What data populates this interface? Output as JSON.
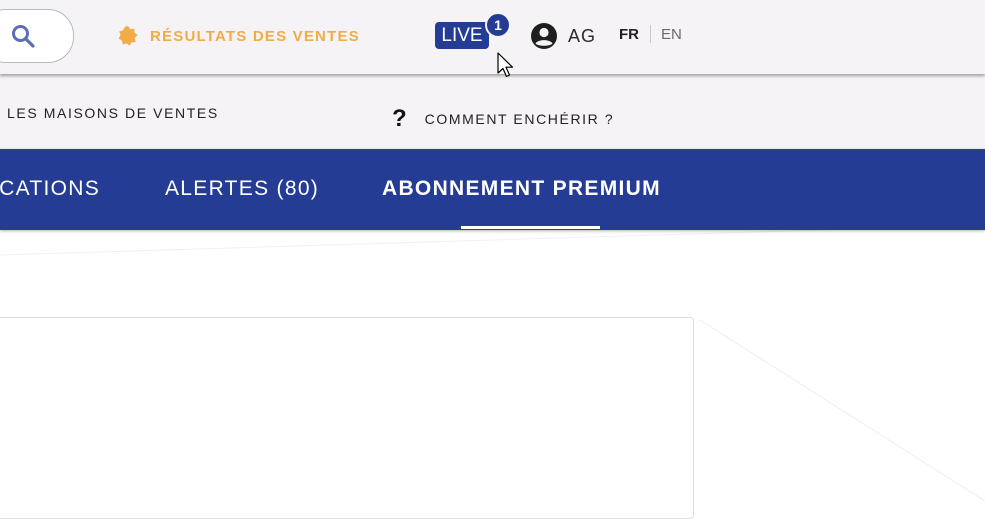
{
  "header": {
    "search_icon": "search-icon",
    "sales_results": {
      "icon": "seal-badge-icon",
      "label": "RÉSULTATS DES VENTES",
      "color": "#f2ac45"
    },
    "live": {
      "label": "LIVE",
      "count": "1",
      "color": "#243c93"
    },
    "account": {
      "icon": "account-circle-icon",
      "initials": "AG"
    },
    "languages": {
      "active": "FR",
      "other": "EN"
    }
  },
  "subnav": {
    "auction_houses": "LES MAISONS DE VENTES",
    "how_to_bid": {
      "icon": "question-mark-icon",
      "label": "COMMENT ENCHÉRIR ?"
    }
  },
  "tabs": {
    "items": [
      {
        "label": "ICATIONS"
      },
      {
        "label": "ALERTES (80)"
      },
      {
        "label": "ABONNEMENT PREMIUM",
        "active": true
      }
    ],
    "background": "#243c93"
  }
}
